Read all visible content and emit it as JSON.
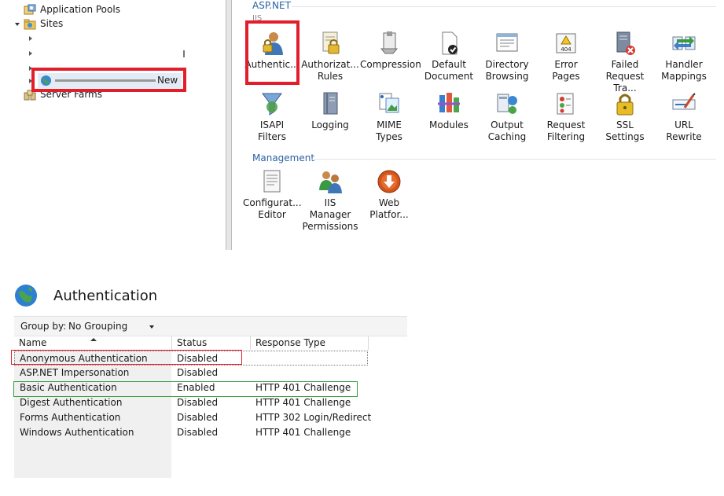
{
  "tree": {
    "items": [
      {
        "label": "Application Pools"
      },
      {
        "label": "Sites"
      },
      {
        "label": ""
      },
      {
        "label": ""
      },
      {
        "label": ""
      },
      {
        "label": "New"
      },
      {
        "label": "Server Farms"
      }
    ]
  },
  "features": {
    "section_aspnet": "ASP.NET",
    "section_iis": "IIS",
    "section_management": "Management",
    "tiles": [
      {
        "label": "Authentic...",
        "icon": "authentication-icon"
      },
      {
        "label": "Authorizat... Rules",
        "icon": "authorization-rules-icon"
      },
      {
        "label": "Compression",
        "icon": "compression-icon"
      },
      {
        "label": "Default Document",
        "icon": "default-document-icon"
      },
      {
        "label": "Directory Browsing",
        "icon": "directory-browsing-icon"
      },
      {
        "label": "Error Pages",
        "icon": "error-pages-icon"
      },
      {
        "label": "Failed Request Tra...",
        "icon": "failed-request-tracing-icon"
      },
      {
        "label": "Handler Mappings",
        "icon": "handler-mappings-icon"
      },
      {
        "label": "ISAPI Filters",
        "icon": "isapi-filters-icon"
      },
      {
        "label": "Logging",
        "icon": "logging-icon"
      },
      {
        "label": "MIME Types",
        "icon": "mime-types-icon"
      },
      {
        "label": "Modules",
        "icon": "modules-icon"
      },
      {
        "label": "Output Caching",
        "icon": "output-caching-icon"
      },
      {
        "label": "Request Filtering",
        "icon": "request-filtering-icon"
      },
      {
        "label": "SSL Settings",
        "icon": "ssl-settings-icon"
      },
      {
        "label": "URL Rewrite",
        "icon": "url-rewrite-icon"
      },
      {
        "label": "Configurat... Editor",
        "icon": "configuration-editor-icon"
      },
      {
        "label": "IIS Manager Permissions",
        "icon": "iis-manager-permissions-icon"
      },
      {
        "label": "Web Platfor...",
        "icon": "web-platform-installer-icon"
      }
    ]
  },
  "auth": {
    "title": "Authentication",
    "group_by_label": "Group by:",
    "group_by_value": "No Grouping",
    "columns": [
      "Name",
      "Status",
      "Response Type"
    ],
    "rows": [
      {
        "name": "Anonymous Authentication",
        "status": "Disabled",
        "response": ""
      },
      {
        "name": "ASP.NET Impersonation",
        "status": "Disabled",
        "response": ""
      },
      {
        "name": "Basic Authentication",
        "status": "Enabled",
        "response": "HTTP 401 Challenge"
      },
      {
        "name": "Digest Authentication",
        "status": "Disabled",
        "response": "HTTP 401 Challenge"
      },
      {
        "name": "Forms Authentication",
        "status": "Disabled",
        "response": "HTTP 302 Login/Redirect"
      },
      {
        "name": "Windows Authentication",
        "status": "Disabled",
        "response": "HTTP 401 Challenge"
      }
    ]
  },
  "colors": {
    "highlight_red": "#e21e2d",
    "highlight_green": "#2e9e3e",
    "section_blue": "#2a62a3"
  }
}
